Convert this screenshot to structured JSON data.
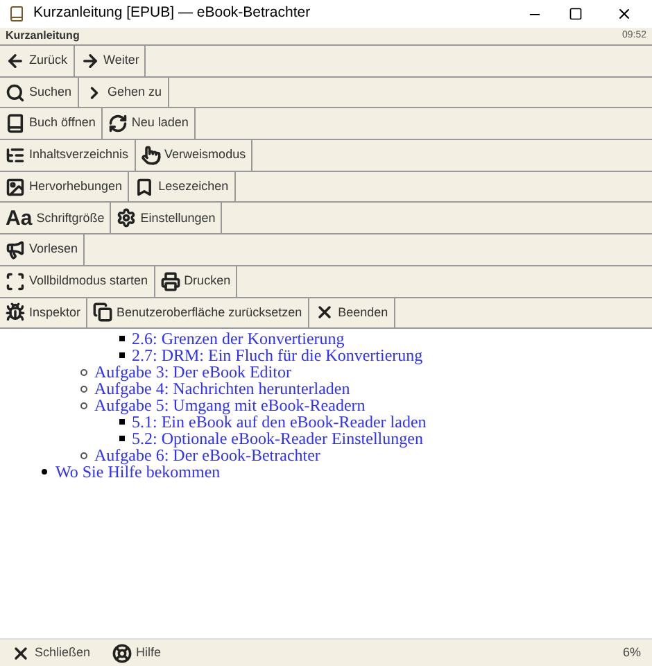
{
  "window": {
    "title": "Kurzanleitung [EPUB] — eBook-Betrachter"
  },
  "header": {
    "title": "Kurzanleitung",
    "clock": "09:52"
  },
  "toolbar_rows": [
    [
      {
        "kind": "back",
        "label": "Zurück"
      },
      {
        "kind": "forward",
        "label": "Weiter"
      }
    ],
    [
      {
        "kind": "search",
        "label": "Suchen"
      },
      {
        "kind": "goto",
        "label": "Gehen zu"
      }
    ],
    [
      {
        "kind": "book",
        "label": "Buch öffnen"
      },
      {
        "kind": "reload",
        "label": "Neu laden"
      }
    ],
    [
      {
        "kind": "toc",
        "label": "Inhaltsverzeichnis"
      },
      {
        "kind": "pointer",
        "label": "Verweismodus"
      }
    ],
    [
      {
        "kind": "image",
        "label": "Hervorhebungen"
      },
      {
        "kind": "bookmark",
        "label": "Lesezeichen"
      }
    ],
    [
      {
        "kind": "font",
        "label": "Schriftgröße",
        "icon_text": "Aa"
      },
      {
        "kind": "settings",
        "label": "Einstellungen"
      }
    ],
    [
      {
        "kind": "speak",
        "label": "Vorlesen"
      }
    ],
    [
      {
        "kind": "fullscreen",
        "label": "Vollbildmodus starten"
      },
      {
        "kind": "print",
        "label": "Drucken"
      }
    ],
    [
      {
        "kind": "bug",
        "label": "Inspektor"
      },
      {
        "kind": "windows",
        "label": "Benutzeroberfläche zurücksetzen"
      },
      {
        "kind": "quit",
        "label": "Beenden"
      }
    ]
  ],
  "toc": [
    {
      "children": [
        {
          "children": [
            {
              "label": "2.6: Grenzen der Konvertierung"
            },
            {
              "label": "2.7: DRM: Ein Fluch für die Konvertierung"
            }
          ]
        },
        {
          "label": "Aufgabe 3: Der eBook Editor"
        },
        {
          "label": "Aufgabe 4: Nachrichten herunterladen"
        },
        {
          "label": "Aufgabe 5: Umgang mit eBook-Readern",
          "children": [
            {
              "label": "5.1: Ein eBook auf den eBook-Reader laden"
            },
            {
              "label": "5.2: Optionale eBook-Reader Einstellungen"
            }
          ]
        },
        {
          "label": "Aufgabe 6: Der eBook-Betrachter"
        }
      ]
    },
    {
      "label": "Wo Sie Hilfe bekommen"
    }
  ],
  "footer": {
    "buttons": [
      {
        "kind": "quit",
        "label": "Schließen"
      },
      {
        "kind": "help",
        "label": "Hilfe"
      }
    ],
    "progress": "6%"
  }
}
